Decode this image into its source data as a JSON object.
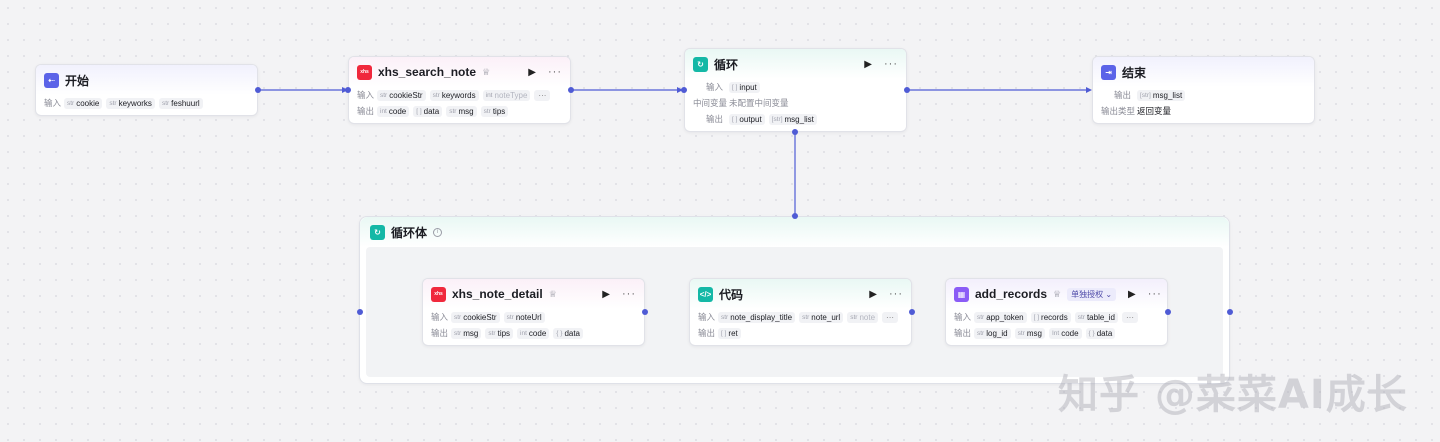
{
  "nodes": {
    "start": {
      "title": "开始",
      "input_label": "输入",
      "inputs": [
        {
          "type": "str",
          "name": "cookie"
        },
        {
          "type": "str",
          "name": "keyworks"
        },
        {
          "type": "str",
          "name": "feshuurl"
        }
      ]
    },
    "search_note": {
      "badge": "xhs",
      "title": "xhs_search_note",
      "input_label": "输入",
      "output_label": "输出",
      "inputs": [
        {
          "type": "str",
          "name": "cookieStr"
        },
        {
          "type": "str",
          "name": "keywords"
        },
        {
          "type": "int",
          "name": "noteType"
        }
      ],
      "outputs": [
        {
          "type": "int",
          "name": "code"
        },
        {
          "type": "[ ]",
          "name": "data"
        },
        {
          "type": "str",
          "name": "msg"
        },
        {
          "type": "str",
          "name": "tips"
        }
      ],
      "more": "···"
    },
    "loop": {
      "title": "循环",
      "input_label": "输入",
      "mid_label": "中间变量",
      "mid_value": "未配置中间变量",
      "output_label": "输出",
      "input": {
        "type": "[ ]",
        "name": "input"
      },
      "outputs": [
        {
          "type": "[ ]",
          "name": "output"
        },
        {
          "type": "[str]",
          "name": "msg_list"
        }
      ]
    },
    "end": {
      "title": "结束",
      "output_label": "输出",
      "output": {
        "type": "[str]",
        "name": "msg_list"
      },
      "output_type_label": "输出类型",
      "output_type_value": "返回变量"
    },
    "loop_body": {
      "title": "循环体",
      "info": "i"
    },
    "note_detail": {
      "badge": "xhs",
      "title": "xhs_note_detail",
      "input_label": "输入",
      "output_label": "输出",
      "inputs": [
        {
          "type": "str",
          "name": "cookieStr"
        },
        {
          "type": "str",
          "name": "noteUrl"
        }
      ],
      "outputs": [
        {
          "type": "str",
          "name": "msg"
        },
        {
          "type": "str",
          "name": "tips"
        },
        {
          "type": "int",
          "name": "code"
        },
        {
          "type": "{ }",
          "name": "data"
        }
      ]
    },
    "code": {
      "title": "代码",
      "input_label": "输入",
      "output_label": "输出",
      "inputs": [
        {
          "type": "str",
          "name": "note_display_title"
        },
        {
          "type": "str",
          "name": "note_url"
        },
        {
          "type": "str",
          "name": "note"
        }
      ],
      "outputs": [
        {
          "type": "[ ]",
          "name": "ret"
        }
      ],
      "more": "···"
    },
    "add_records": {
      "title": "add_records",
      "auth_tag": "单独授权 ⌄",
      "input_label": "输入",
      "output_label": "输出",
      "inputs": [
        {
          "type": "str",
          "name": "app_token"
        },
        {
          "type": "[ ]",
          "name": "records"
        },
        {
          "type": "str",
          "name": "table_id"
        }
      ],
      "outputs": [
        {
          "type": "str",
          "name": "log_id"
        },
        {
          "type": "str",
          "name": "msg"
        },
        {
          "type": "Int",
          "name": "code"
        },
        {
          "type": "{ }",
          "name": "data"
        }
      ],
      "more": "···"
    }
  },
  "controls": {
    "run": "▶",
    "menu": "···",
    "verified": "♕"
  },
  "watermark": "知乎 @菜菜AI成长",
  "colors": {
    "edge": "#4f5bd5",
    "plugin_badge": "#f0283c",
    "loop_badge": "#14b8a6",
    "start_badge": "#5b63e8",
    "db_badge": "#8b5cf6"
  }
}
